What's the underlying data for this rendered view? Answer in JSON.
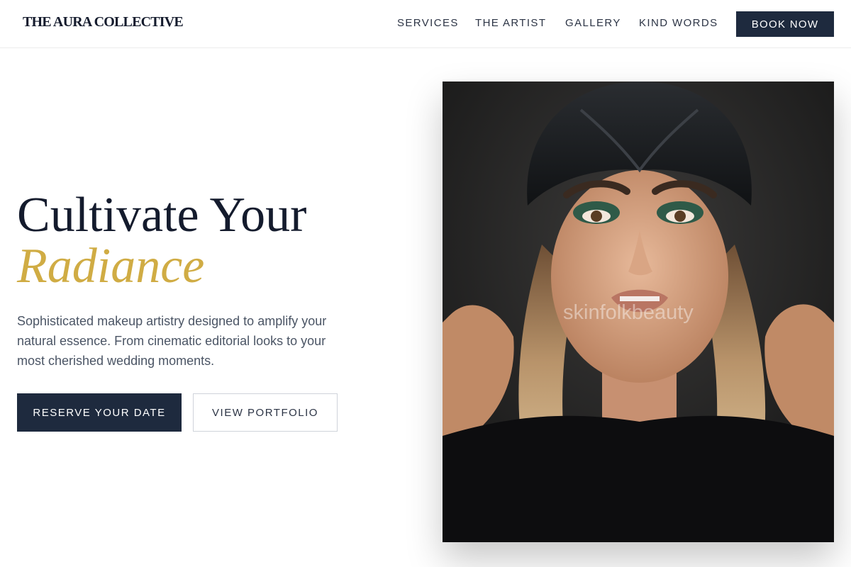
{
  "header": {
    "brand": "THE AURA COLLECTIVE",
    "nav": [
      {
        "label": "SERVICES"
      },
      {
        "label": "THE ARTIST"
      },
      {
        "label": "GALLERY"
      },
      {
        "label": "KIND WORDS"
      }
    ],
    "cta_label": "BOOK NOW"
  },
  "hero": {
    "title_line1": "Cultivate Your",
    "title_line2": "Radiance",
    "description": "Sophisticated makeup artistry designed to amplify your natural essence. From cinematic editorial looks to your most cherished wedding moments.",
    "primary_button": "RESERVE YOUR DATE",
    "secondary_button": "VIEW PORTFOLIO",
    "photo_watermark": "skinfolkbeauty"
  },
  "colors": {
    "navy": "#1e2a3e",
    "gold_accent": "#d0ac44",
    "body_text": "#4b5565"
  }
}
